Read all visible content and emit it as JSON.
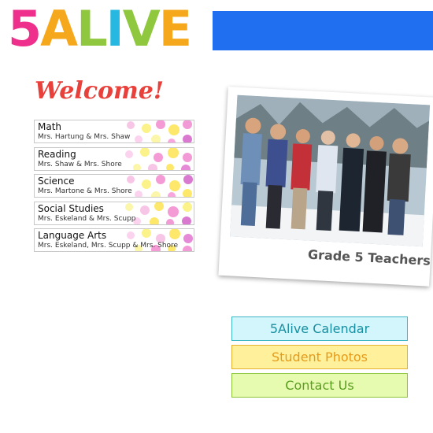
{
  "header": {
    "logo_letters": [
      "5",
      "A",
      "L",
      "I",
      "V",
      "E"
    ],
    "logo_colors": [
      "#ee2f8c",
      "#f6a81c",
      "#8fc73e",
      "#26b8e0",
      "#8fc73e",
      "#f6a81c"
    ],
    "bar_color": "#1f6ff0"
  },
  "welcome": "Welcome!",
  "subjects": [
    {
      "name": "Math",
      "teachers": "Mrs. Hartung & Mrs. Shaw"
    },
    {
      "name": "Reading",
      "teachers": "Mrs. Shaw & Mrs. Shore"
    },
    {
      "name": "Science",
      "teachers": "Mrs. Martone & Mrs. Shore"
    },
    {
      "name": "Social Studies",
      "teachers": "Mrs. Eskeland & Mrs. Scupp"
    },
    {
      "name": "Language Arts",
      "teachers": "Mrs. Eskeland, Mrs. Scupp & Mrs. Shore"
    }
  ],
  "photo": {
    "caption": "Grade 5 Teachers"
  },
  "buttons": {
    "calendar": "5Alive Calendar",
    "photos": "Student Photos",
    "contact": "Contact Us"
  }
}
